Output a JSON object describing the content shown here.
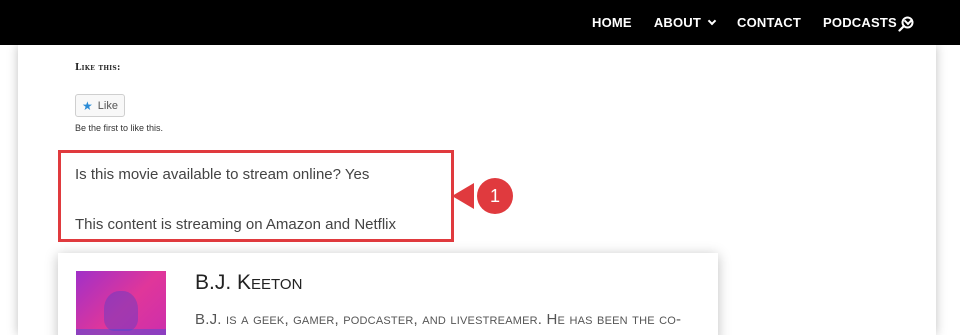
{
  "nav": {
    "items": [
      {
        "label": "HOME",
        "has_dropdown": false
      },
      {
        "label": "ABOUT",
        "has_dropdown": true
      },
      {
        "label": "CONTACT",
        "has_dropdown": false
      },
      {
        "label": "PODCASTS",
        "has_dropdown": true
      }
    ],
    "search_icon": "search-icon"
  },
  "like": {
    "heading": "Like this:",
    "button_label": "Like",
    "icon": "star-icon",
    "first_text": "Be the first to like this."
  },
  "streaming": {
    "question": "Is this movie available to stream online? Yes",
    "services": "This content is streaming on Amazon and Netflix",
    "callout_number": "1",
    "highlight_color": "#e03a3e"
  },
  "author": {
    "name": "B.J. Keeton",
    "bio": "B.J. is a geek, gamer, podcaster, and livestreamer. He has been the co-"
  }
}
